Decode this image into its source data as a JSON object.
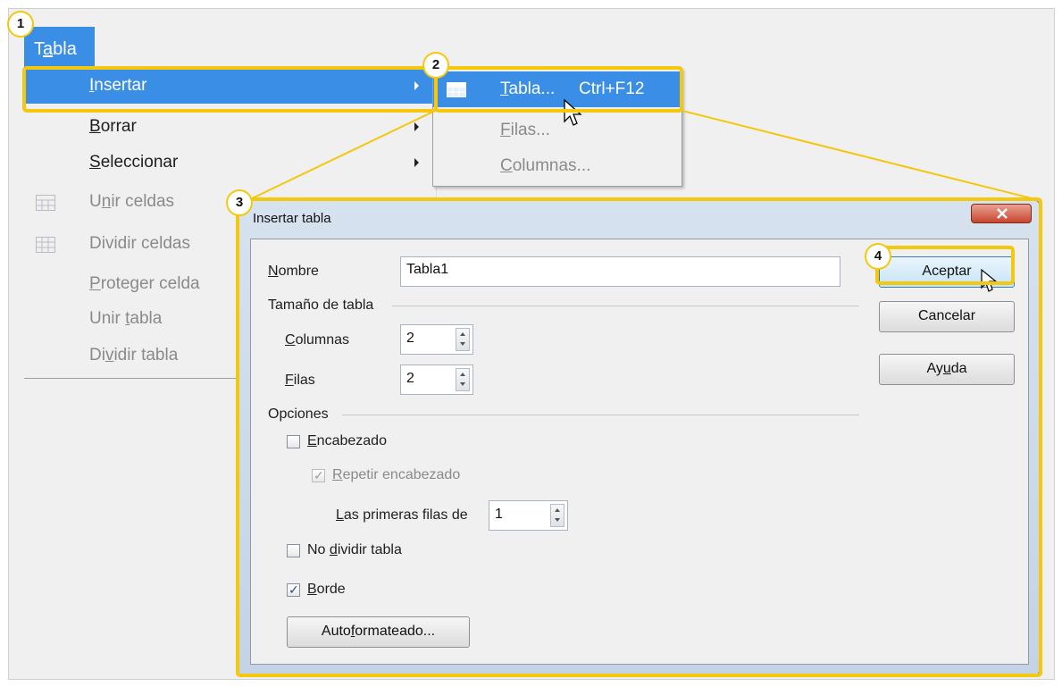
{
  "menubar": {
    "tabla": "Tabla"
  },
  "menu": {
    "items": [
      {
        "label": "Insertar",
        "selected": true,
        "disabled": false,
        "submenu": true
      },
      {
        "label": "Borrar",
        "disabled": false,
        "submenu": true
      },
      {
        "label": "Seleccionar",
        "disabled": false,
        "submenu": true
      },
      {
        "label": "Unir celdas",
        "disabled": true,
        "icon": "merge-cells-icon"
      },
      {
        "label": "Dividir celdas",
        "disabled": true,
        "icon": "split-cells-icon"
      },
      {
        "label": "Proteger celda",
        "disabled": true
      },
      {
        "label": "Unir tabla",
        "disabled": true
      },
      {
        "label": "Dividir tabla",
        "disabled": true
      }
    ]
  },
  "submenu": {
    "items": [
      {
        "label": "Tabla...",
        "shortcut": "Ctrl+F12",
        "selected": true,
        "icon": "table-icon"
      },
      {
        "label": "Filas...",
        "disabled": true
      },
      {
        "label": "Columnas...",
        "disabled": true
      }
    ]
  },
  "dialog": {
    "title": "Insertar tabla",
    "name_label": "Nombre",
    "name_value": "Tabla1",
    "size_section": "Tamaño de tabla",
    "columns_label": "Columnas",
    "columns_value": "2",
    "rows_label": "Filas",
    "rows_value": "2",
    "options_section": "Opciones",
    "header_label": "Encabezado",
    "header_checked": false,
    "repeat_header_label": "Repetir encabezado",
    "repeat_header_checked": true,
    "first_rows_label": "Las primeras filas de",
    "first_rows_value": "1",
    "no_split_label": "No dividir tabla",
    "no_split_checked": false,
    "border_label": "Borde",
    "border_checked": true,
    "autoformat_button": "Autoformateado...",
    "ok_button": "Aceptar",
    "cancel_button": "Cancelar",
    "help_button": "Ayuda"
  },
  "callouts": {
    "step1": "1",
    "step2": "2",
    "step3": "3",
    "step4": "4"
  },
  "colors": {
    "highlight": "#f3c80e",
    "selection": "#3a8ee6"
  }
}
